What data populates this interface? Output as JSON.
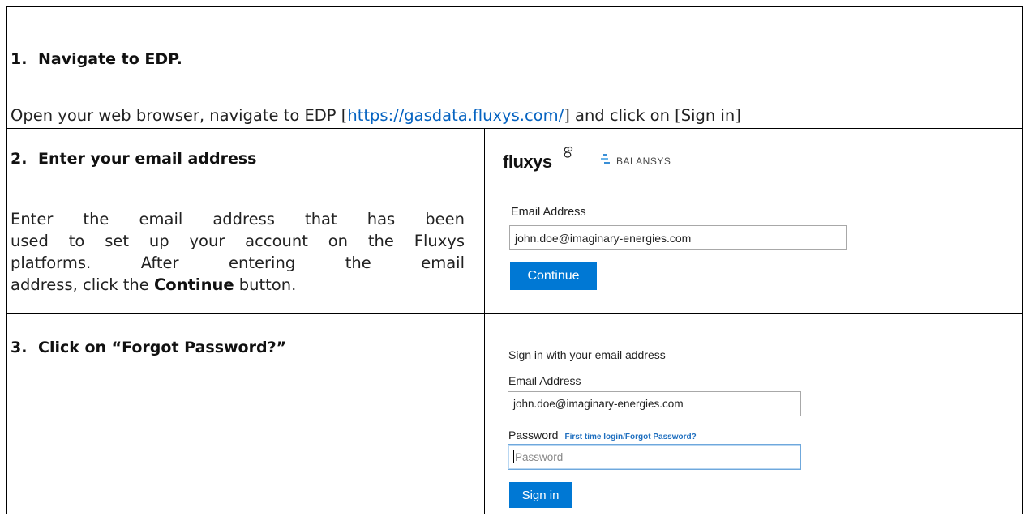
{
  "steps": [
    {
      "number": "1.",
      "title": "Navigate to EDP."
    },
    {
      "number": "2.",
      "title": "Enter your email address"
    },
    {
      "number": "3.",
      "title": "Click on “Forgot Password?”"
    }
  ],
  "step1": {
    "text_before": "Open your web browser, navigate to EDP [",
    "link": "https://gasdata.fluxys.com/",
    "text_after": "] and click on [Sign in]"
  },
  "step2": {
    "lines": [
      "Enter the email address that has been",
      "used to set up your account on the Fluxys",
      "platforms. After entering the email"
    ],
    "last_line_before": "address, click the ",
    "last_line_bold": "Continue",
    "last_line_after": " button."
  },
  "panel1": {
    "logo_fluxys": "fluxys",
    "logo_balansys": "BALANSYS",
    "email_label": "Email Address",
    "email_value": "john.doe@imaginary-energies.com",
    "continue_label": "Continue"
  },
  "panel2": {
    "heading": "Sign in with your email address",
    "email_label": "Email Address",
    "email_value": "john.doe@imaginary-energies.com",
    "password_label": "Password",
    "forgot_link": "First time login/Forgot Password?",
    "password_placeholder": "Password",
    "signin_label": "Sign in"
  },
  "colors": {
    "link": "#0563c1",
    "button": "#0078d4",
    "forgot_link": "#1f6fbf"
  }
}
